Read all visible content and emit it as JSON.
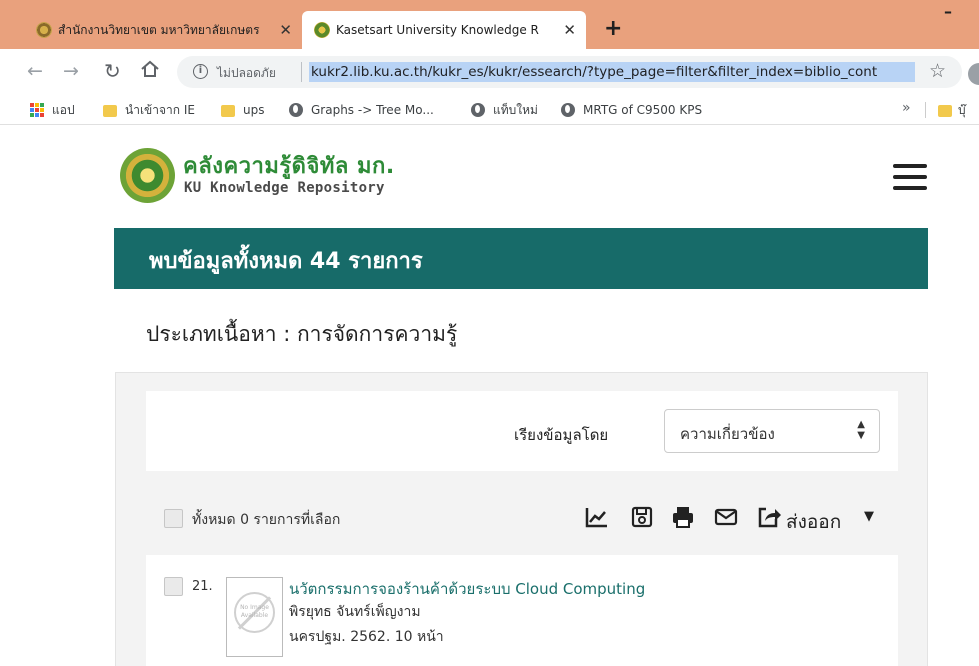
{
  "browser": {
    "tabs": [
      {
        "title": "สำนักงานวิทยาเขต มหาวิทยาลัยเกษตร",
        "active": false
      },
      {
        "title": "Kasetsart University Knowledge R",
        "active": true
      }
    ],
    "new_tab_glyph": "+",
    "minimize_glyph": "–",
    "address": {
      "security_label": "ไม่ปลอดภัย",
      "url": "kukr2.lib.ku.ac.th/kukr_es/kukr/essearch/?type_page=filter&filter_index=biblio_cont"
    },
    "bookmarks": [
      {
        "label": "แอป",
        "kind": "apps"
      },
      {
        "label": "นำเข้าจาก IE",
        "kind": "folder"
      },
      {
        "label": "ups",
        "kind": "folder"
      },
      {
        "label": "Graphs -> Tree Mo...",
        "kind": "globe"
      },
      {
        "label": "แท็บใหม่",
        "kind": "globe"
      },
      {
        "label": "MRTG of C9500 KPS",
        "kind": "globe"
      }
    ],
    "bookmarks_more": "»",
    "bookmarks_other": "บุ๊"
  },
  "site": {
    "name_th": "คลังความรู้ดิจิทัล มก.",
    "name_en": "KU Knowledge Repository"
  },
  "results": {
    "summary": "พบข้อมูลทั้งหมด 44 รายการ",
    "content_type": "ประเภทเนื้อหา : การจัดการความรู้",
    "sort_label": "เรียงข้อมูลโดย",
    "sort_value": "ความเกี่ยวข้อง",
    "selected_label": "ทั้งหมด 0 รายการที่เลือก",
    "export_label": "ส่งออก",
    "items": [
      {
        "number": "21.",
        "title": "นวัตกรรมการจองร้านค้าด้วยระบบ Cloud Computing",
        "author": "พิรยุทธ จันทร์เพ็ญงาม",
        "publication": "นครปฐม. 2562. 10 หน้า",
        "thumbnail_text": "No Image Available"
      }
    ]
  },
  "colors": {
    "tab_strip": "#e9a17d",
    "banner": "#176b69",
    "site_green": "#2e8b37",
    "link": "#1a6f6b"
  }
}
